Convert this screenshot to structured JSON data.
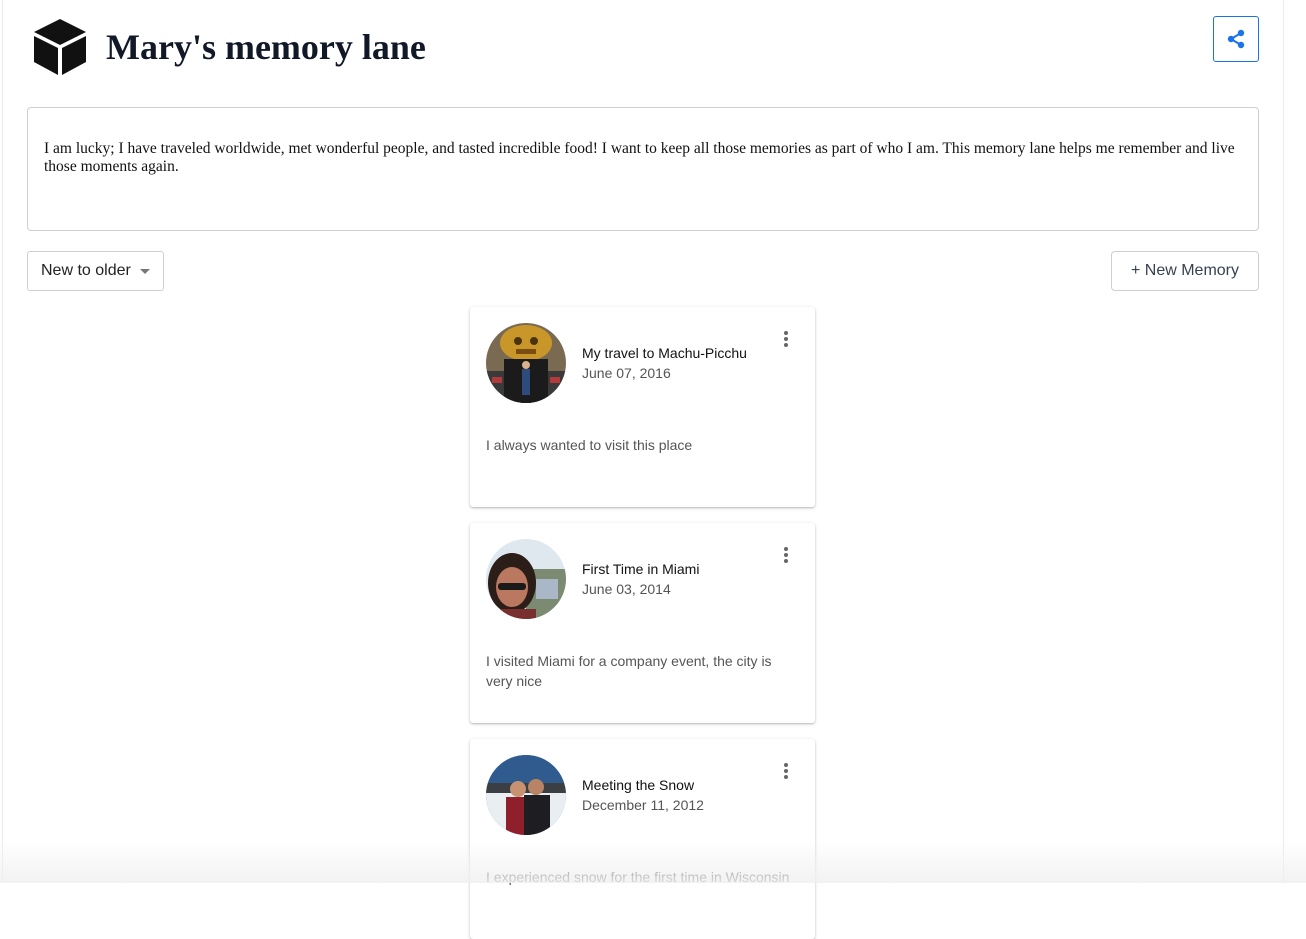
{
  "header": {
    "title": "Mary's memory lane",
    "logo_icon": "cube-icon",
    "share_icon": "share-icon",
    "accent_color": "#1a73e8"
  },
  "description": "I am lucky; I have traveled worldwide, met wonderful people, and tasted incredible food! I want to keep all those memories as part of who I am. This memory lane helps me remember and live those moments again.",
  "toolbar": {
    "sort_selected": "New to older",
    "new_memory_label": "+ New Memory"
  },
  "memories": [
    {
      "title": "My travel to Machu-Picchu",
      "date": "June 07, 2016",
      "body": "I always wanted to visit this place"
    },
    {
      "title": "First Time in Miami",
      "date": "June 03, 2014",
      "body": "I visited Miami for a company event, the city is very nice"
    },
    {
      "title": "Meeting the Snow",
      "date": "December 11, 2012",
      "body": "I experienced snow for the first time in Wisconsin"
    }
  ]
}
